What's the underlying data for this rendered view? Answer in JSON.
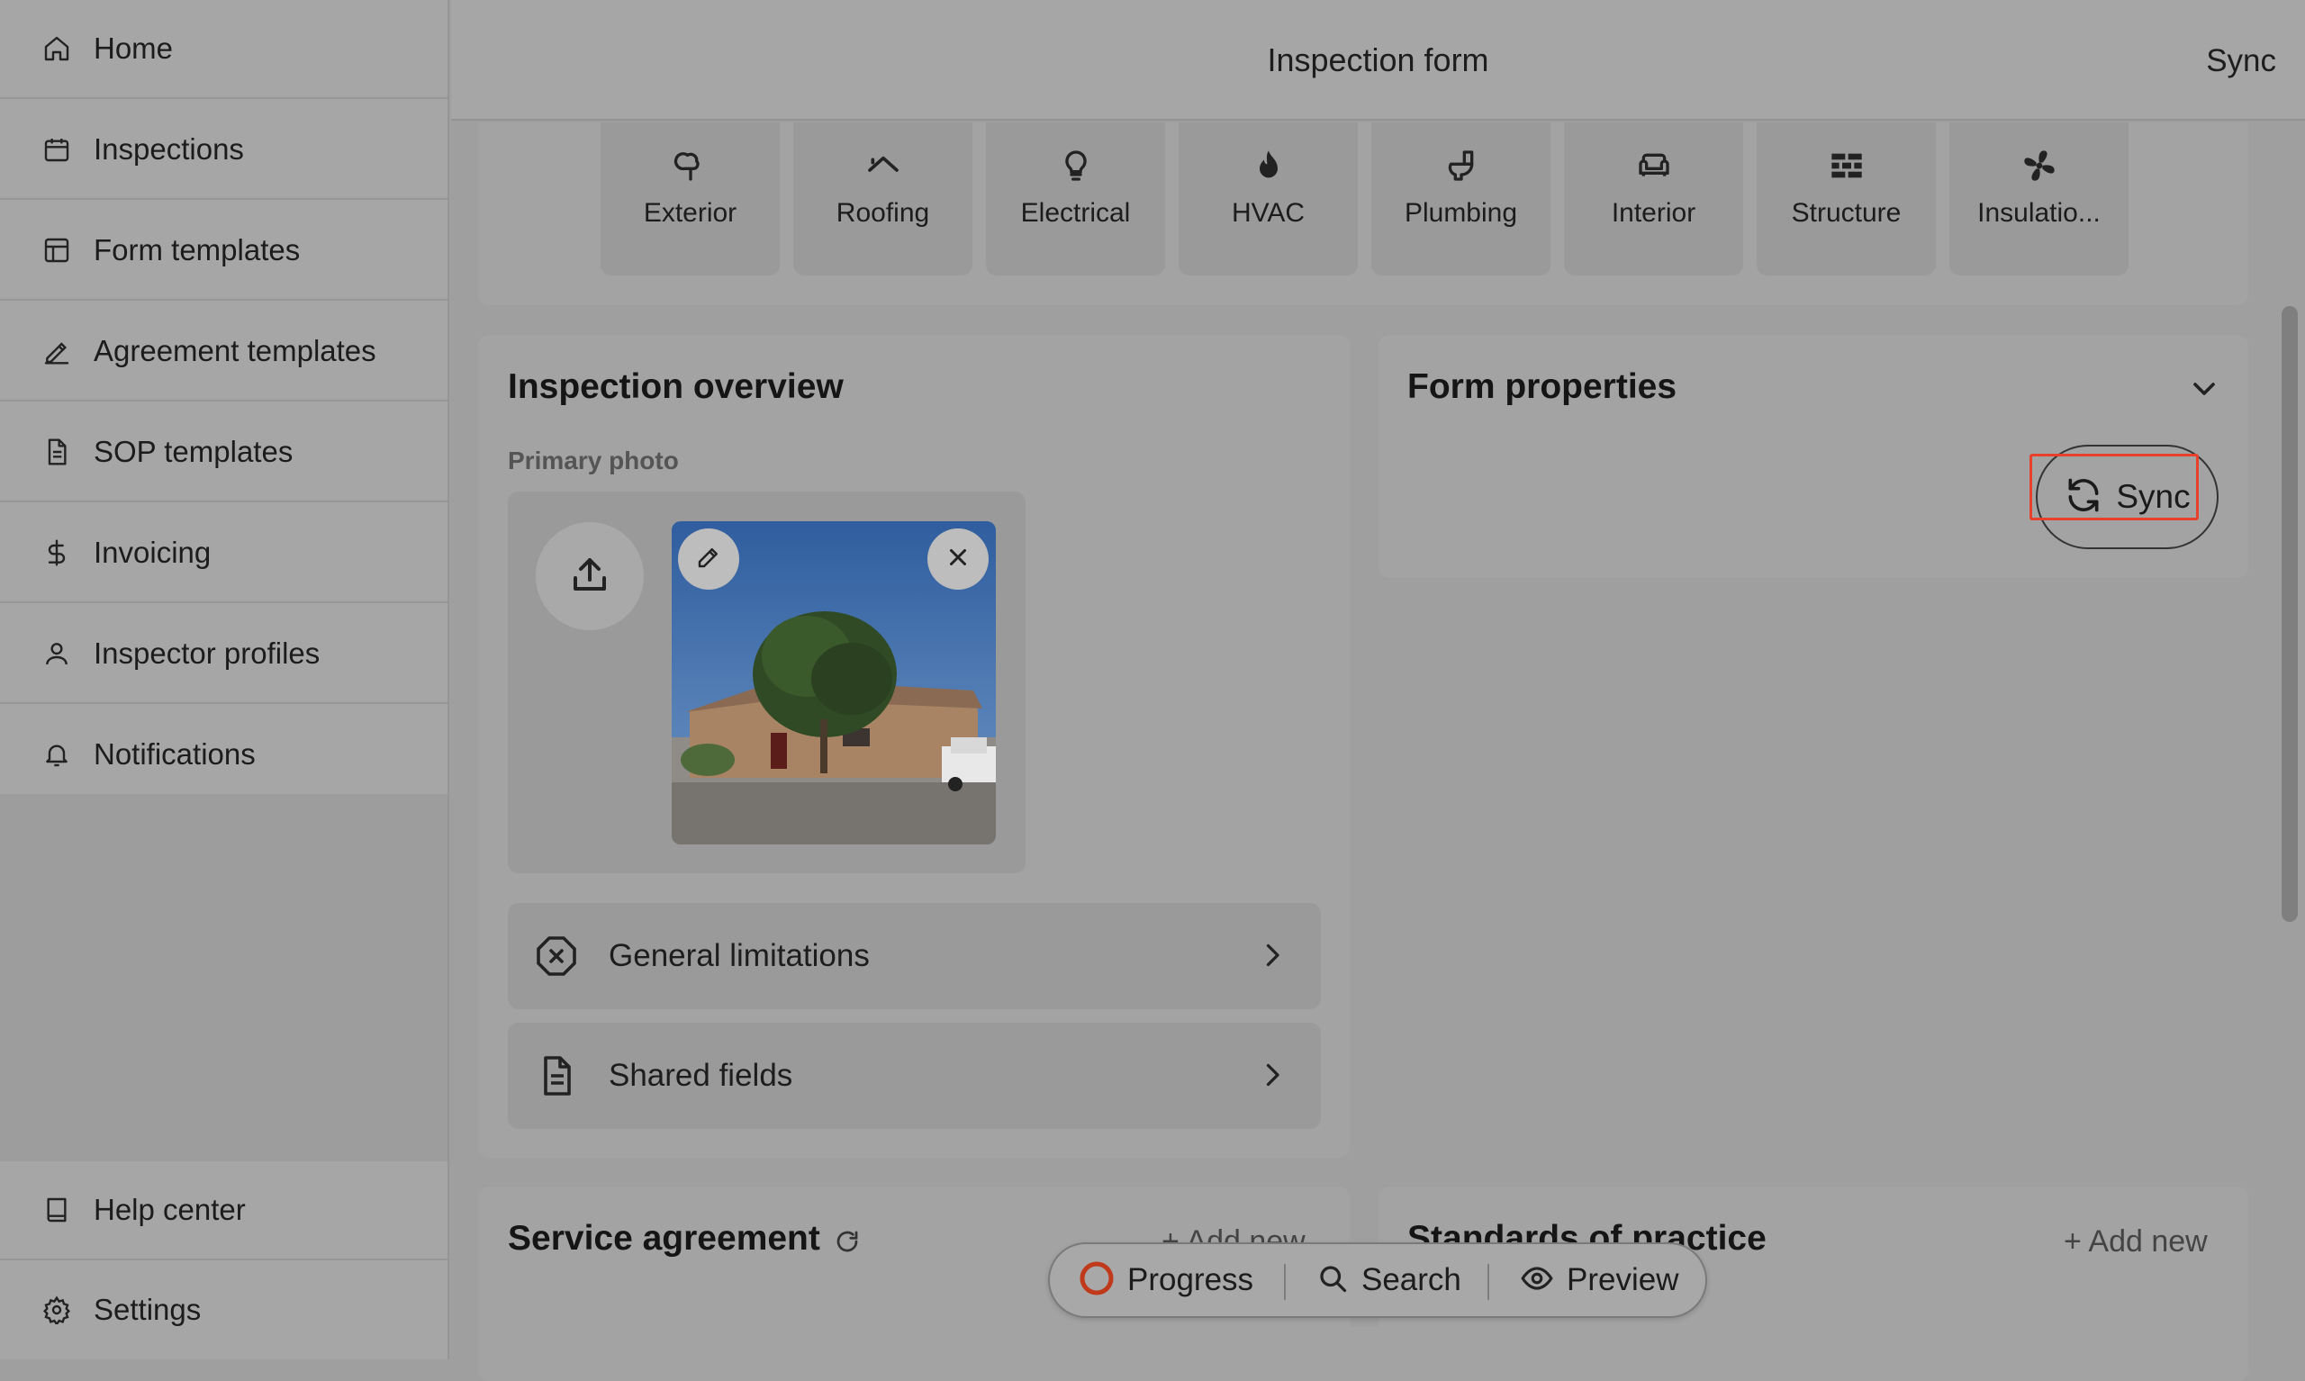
{
  "header": {
    "title": "Inspection form",
    "sync_label": "Sync"
  },
  "sidebar": {
    "items": [
      {
        "label": "Home",
        "icon": "home-icon"
      },
      {
        "label": "Inspections",
        "icon": "calendar-icon"
      },
      {
        "label": "Form templates",
        "icon": "template-icon"
      },
      {
        "label": "Agreement templates",
        "icon": "signature-icon"
      },
      {
        "label": "SOP templates",
        "icon": "document-icon"
      },
      {
        "label": "Invoicing",
        "icon": "dollar-icon"
      },
      {
        "label": "Inspector profiles",
        "icon": "user-icon"
      },
      {
        "label": "Notifications",
        "icon": "bell-icon"
      }
    ],
    "bottom_items": [
      {
        "label": "Help center",
        "icon": "book-icon"
      },
      {
        "label": "Settings",
        "icon": "gear-icon"
      }
    ]
  },
  "categories": [
    {
      "label": "Exterior",
      "icon": "tree-icon"
    },
    {
      "label": "Roofing",
      "icon": "roof-icon"
    },
    {
      "label": "Electrical",
      "icon": "lightbulb-icon"
    },
    {
      "label": "HVAC",
      "icon": "flame-icon"
    },
    {
      "label": "Plumbing",
      "icon": "toilet-icon"
    },
    {
      "label": "Interior",
      "icon": "sofa-icon"
    },
    {
      "label": "Structure",
      "icon": "bricks-icon"
    },
    {
      "label": "Insulatio...",
      "icon": "fan-icon"
    }
  ],
  "overview": {
    "title": "Inspection overview",
    "primary_photo_label": "Primary photo",
    "rows": [
      {
        "label": "General limitations",
        "icon": "circle-x-icon"
      },
      {
        "label": "Shared fields",
        "icon": "document-icon"
      }
    ]
  },
  "form_properties": {
    "title": "Form properties",
    "sync_label": "Sync"
  },
  "service_agreement": {
    "title": "Service agreement",
    "add_label": "+ Add new"
  },
  "standards": {
    "title": "Standards of practice",
    "add_label": "+ Add new"
  },
  "floatbar": {
    "progress_label": "Progress",
    "search_label": "Search",
    "preview_label": "Preview"
  },
  "colors": {
    "highlight": "#e8412b",
    "progress_ring": "#c0391b"
  }
}
